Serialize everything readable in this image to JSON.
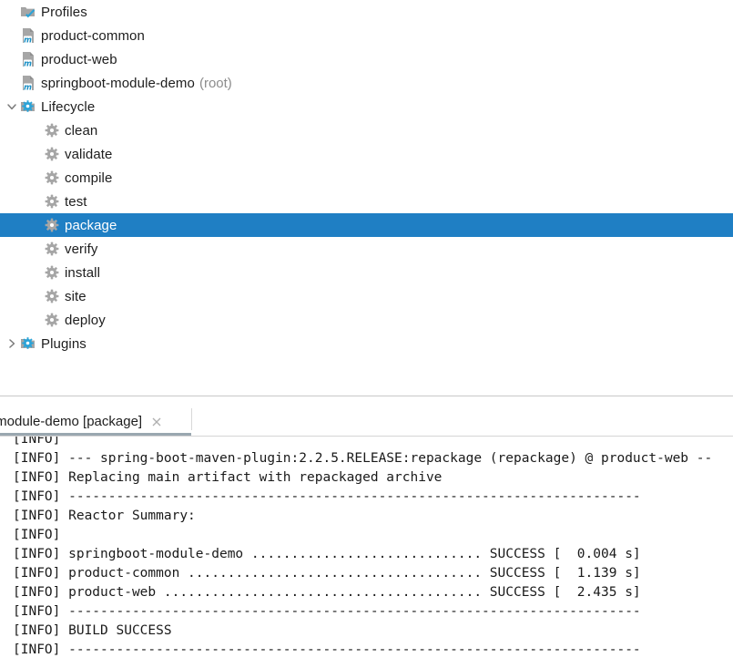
{
  "maven_tree": {
    "rows": [
      {
        "label": "Profiles",
        "suffix": "",
        "icon": "profiles-folder-icon",
        "twisty": "none",
        "indent": "lvl0",
        "selected": false
      },
      {
        "label": "product-common",
        "suffix": "",
        "icon": "maven-module-icon",
        "twisty": "none",
        "indent": "lvl0",
        "selected": false
      },
      {
        "label": "product-web",
        "suffix": "",
        "icon": "maven-module-icon",
        "twisty": "none",
        "indent": "lvl0",
        "selected": false
      },
      {
        "label": "springboot-module-demo",
        "suffix": "(root)",
        "icon": "maven-module-icon",
        "twisty": "none",
        "indent": "lvl0",
        "selected": false
      },
      {
        "label": "Lifecycle",
        "suffix": "",
        "icon": "lifecycle-folder-icon",
        "twisty": "expanded",
        "indent": "lvl1",
        "selected": false
      },
      {
        "label": "clean",
        "suffix": "",
        "icon": "gear-icon",
        "twisty": "none",
        "indent": "lvl2",
        "selected": false
      },
      {
        "label": "validate",
        "suffix": "",
        "icon": "gear-icon",
        "twisty": "none",
        "indent": "lvl2",
        "selected": false
      },
      {
        "label": "compile",
        "suffix": "",
        "icon": "gear-icon",
        "twisty": "none",
        "indent": "lvl2",
        "selected": false
      },
      {
        "label": "test",
        "suffix": "",
        "icon": "gear-icon",
        "twisty": "none",
        "indent": "lvl2",
        "selected": false
      },
      {
        "label": "package",
        "suffix": "",
        "icon": "gear-icon",
        "twisty": "none",
        "indent": "lvl2",
        "selected": true
      },
      {
        "label": "verify",
        "suffix": "",
        "icon": "gear-icon",
        "twisty": "none",
        "indent": "lvl2",
        "selected": false
      },
      {
        "label": "install",
        "suffix": "",
        "icon": "gear-icon",
        "twisty": "none",
        "indent": "lvl2",
        "selected": false
      },
      {
        "label": "site",
        "suffix": "",
        "icon": "gear-icon",
        "twisty": "none",
        "indent": "lvl2",
        "selected": false
      },
      {
        "label": "deploy",
        "suffix": "",
        "icon": "gear-icon",
        "twisty": "none",
        "indent": "lvl2",
        "selected": false
      },
      {
        "label": "Plugins",
        "suffix": "",
        "icon": "plugins-folder-icon",
        "twisty": "collapsed",
        "indent": "lvl1",
        "selected": false
      }
    ],
    "selection_color": "#1f7fc4",
    "suffix_color": "#8c8c8c"
  },
  "run_panel": {
    "tab": {
      "title": "t-module-demo [package]",
      "close_icon": "close-icon"
    },
    "console_lines": [
      "[INFO]",
      "[INFO] --- spring-boot-maven-plugin:2.2.5.RELEASE:repackage (repackage) @ product-web --",
      "[INFO] Replacing main artifact with repackaged archive",
      "[INFO] ------------------------------------------------------------------------",
      "[INFO] Reactor Summary:",
      "[INFO]",
      "[INFO] springboot-module-demo ............................. SUCCESS [  0.004 s]",
      "[INFO] product-common ..................................... SUCCESS [  1.139 s]",
      "[INFO] product-web ........................................ SUCCESS [  2.435 s]",
      "[INFO] ------------------------------------------------------------------------",
      "[INFO] BUILD SUCCESS",
      "[INFO] ------------------------------------------------------------------------"
    ]
  }
}
